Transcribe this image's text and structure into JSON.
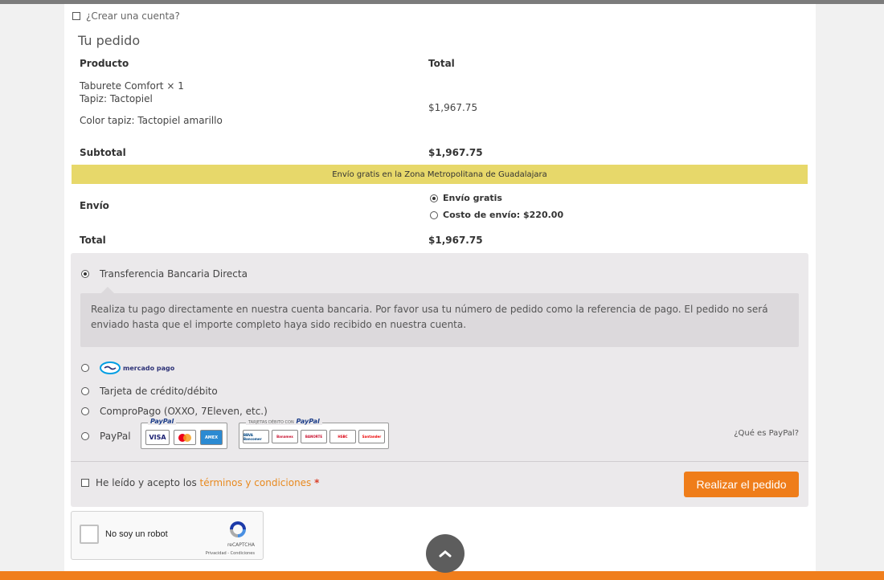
{
  "checkout": {
    "create_account_label": "¿Crear una cuenta?",
    "order_title": "Tu pedido"
  },
  "order_table": {
    "header_product": "Producto",
    "header_total": "Total",
    "item": {
      "name": "Taburete Comfort",
      "quantity": "× 1",
      "attr1_label": "Tapiz:",
      "attr1_value": "Tactopiel",
      "attr2_label": "Color tapiz:",
      "attr2_value": "Tactopiel amarillo",
      "total": "$1,967.75"
    },
    "subtotal_label": "Subtotal",
    "subtotal_value": "$1,967.75",
    "shipping_banner": "Envío gratis en la Zona Metropolitana de Guadalajara",
    "shipping_label": "Envío",
    "shipping_options": [
      {
        "label": "Envío gratis",
        "selected": true
      },
      {
        "label": "Costo de envío: $220.00",
        "selected": false
      }
    ],
    "total_label": "Total",
    "total_value": "$1,967.75"
  },
  "payment": {
    "methods": [
      {
        "label": "Transferencia Bancaria Directa",
        "selected": true
      },
      {
        "label": "Mercado Pago",
        "logo_text": "mercado pago",
        "selected": false
      },
      {
        "label": "Tarjeta de crédito/débito",
        "selected": false
      },
      {
        "label": "ComproPago (OXXO, 7Eleven, etc.)",
        "selected": false
      },
      {
        "label": "PayPal",
        "selected": false
      }
    ],
    "bank_notice": "Realiza tu pago directamente en nuestra cuenta bancaria. Por favor usa tu número de pedido como la referencia de pago. El pedido no será enviado hasta que el importe completo haya sido recibido en nuestra cuenta.",
    "paypal_logo_text": "PayPal",
    "paypal_debit_prefix": "TARJETAS DÉBITO CON",
    "card_brands": [
      "VISA",
      "MC",
      "AMEX"
    ],
    "banks": [
      "BBVA Bancomer",
      "Banamex",
      "BANORTE",
      "HSBC",
      "Santander"
    ],
    "what_is_paypal": "¿Qué es PayPal?"
  },
  "terms": {
    "prefix": "He leído y acepto los",
    "link": "términos y condiciones",
    "required_mark": "*"
  },
  "place_order_label": "Realizar el pedido",
  "recaptcha": {
    "label": "No soy un robot",
    "brand": "reCAPTCHA",
    "links": "Privacidad - Condiciones"
  },
  "colors": {
    "accent": "#ef7d1a",
    "banner": "#e7d86a",
    "payment_bg": "#ebe9eb"
  },
  "icons": {
    "scroll_top": "chevron-up-icon"
  }
}
